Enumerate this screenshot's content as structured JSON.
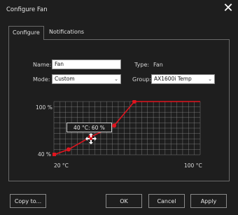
{
  "window": {
    "title": "Configure Fan",
    "close_icon": "close-icon"
  },
  "tabs": [
    {
      "label": "Configure",
      "active": true
    },
    {
      "label": "Notifications",
      "active": false
    }
  ],
  "form": {
    "name_label": "Name:",
    "name_value": "Fan",
    "type_label": "Type:",
    "type_value": "Fan",
    "mode_label": "Mode:",
    "mode_value": "Custom",
    "group_label": "Group:",
    "group_value": "AX1600i  Temp"
  },
  "graph": {
    "y_top_label": "100 %",
    "y_bottom_label": "40 %",
    "x_left_label": "20 °C",
    "x_right_label": "100 °C",
    "tooltip": "40 °C: 60 %",
    "line_color": "#e0141e",
    "grid_color": "#8c8c8c",
    "chart_data": {
      "type": "line",
      "x": [
        20,
        28,
        40,
        53,
        64,
        100
      ],
      "y": [
        40,
        46,
        60,
        73,
        100,
        100
      ],
      "xlim": [
        20,
        100
      ],
      "ylim": [
        40,
        100
      ]
    }
  },
  "buttons": {
    "copy": "Copy to...",
    "ok": "OK",
    "cancel": "Cancel",
    "apply": "Apply"
  }
}
